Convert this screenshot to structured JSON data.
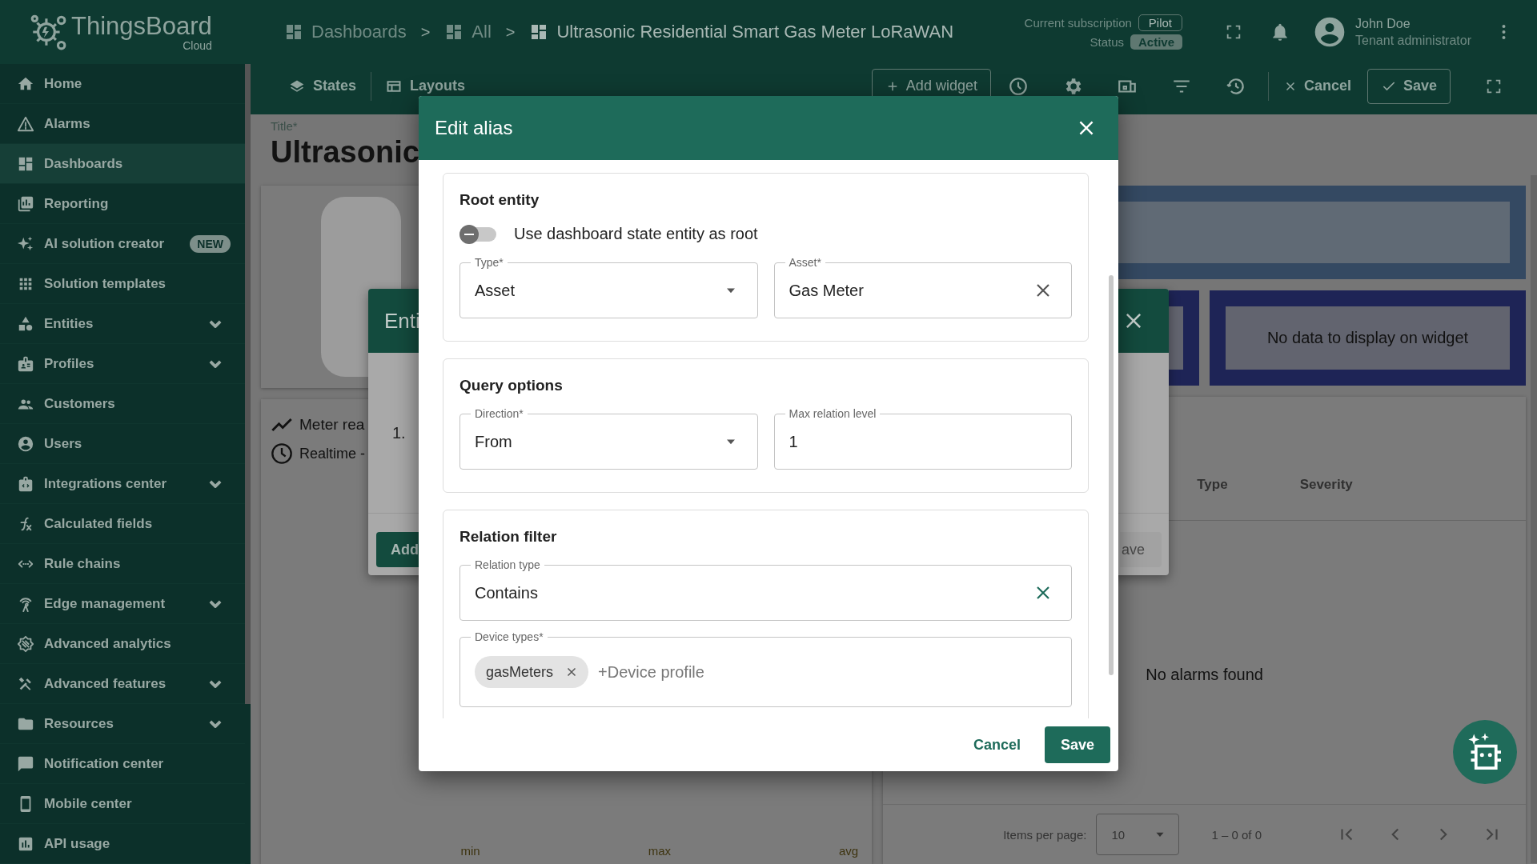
{
  "header": {
    "logo": {
      "name": "ThingsBoard",
      "sub": "Cloud"
    },
    "breadcrumbs": [
      {
        "label": "Dashboards",
        "separator": ">"
      },
      {
        "label": "All",
        "separator": ">"
      },
      {
        "label": "Ultrasonic Residential Smart Gas Meter LoRaWAN"
      }
    ],
    "subscription": {
      "label": "Current subscription",
      "value": "Pilot"
    },
    "status": {
      "label": "Status",
      "value": "Active"
    },
    "user": {
      "name": "John Doe",
      "role": "Tenant administrator"
    }
  },
  "sidebar": {
    "items": [
      {
        "label": "Home",
        "selected": false,
        "expandable": false
      },
      {
        "label": "Alarms",
        "selected": false,
        "expandable": false
      },
      {
        "label": "Dashboards",
        "selected": true,
        "expandable": false
      },
      {
        "label": "Reporting",
        "selected": false,
        "expandable": false
      },
      {
        "label": "AI solution creator",
        "selected": false,
        "expandable": false,
        "badge": "NEW"
      },
      {
        "label": "Solution templates",
        "selected": false,
        "expandable": false
      },
      {
        "label": "Entities",
        "selected": false,
        "expandable": true
      },
      {
        "label": "Profiles",
        "selected": false,
        "expandable": true
      },
      {
        "label": "Customers",
        "selected": false,
        "expandable": false
      },
      {
        "label": "Users",
        "selected": false,
        "expandable": false
      },
      {
        "label": "Integrations center",
        "selected": false,
        "expandable": true
      },
      {
        "label": "Calculated fields",
        "selected": false,
        "expandable": false
      },
      {
        "label": "Rule chains",
        "selected": false,
        "expandable": false
      },
      {
        "label": "Edge management",
        "selected": false,
        "expandable": true
      },
      {
        "label": "Advanced analytics",
        "selected": false,
        "expandable": false
      },
      {
        "label": "Advanced features",
        "selected": false,
        "expandable": true
      },
      {
        "label": "Resources",
        "selected": false,
        "expandable": true
      },
      {
        "label": "Notification center",
        "selected": false,
        "expandable": false
      },
      {
        "label": "Mobile center",
        "selected": false,
        "expandable": false
      },
      {
        "label": "API usage",
        "selected": false,
        "expandable": false
      }
    ]
  },
  "toolbar": {
    "tabs": [
      "States",
      "Layouts"
    ],
    "add_widget": "Add widget",
    "cancel": "Cancel",
    "save": "Save"
  },
  "dashboard": {
    "title_label": "Title*",
    "title": "Ultrasonic",
    "chart_widget": {
      "title": "Meter rea",
      "timewindow": "Realtime - ",
      "legend": [
        "min",
        "max",
        "avg"
      ]
    },
    "no_data": "No data to display on widget",
    "alarms": {
      "columns": [
        "Type",
        "Severity"
      ],
      "empty": "No alarms found",
      "paginator": {
        "label": "Items per page:",
        "page_size": "10",
        "range": "1 – 0 of 0"
      }
    }
  },
  "back_dialog": {
    "title": "Enti",
    "row_number": "1.",
    "add_button": "Add",
    "save_button": "ave"
  },
  "dialog": {
    "title": "Edit alias",
    "sections": [
      {
        "title": "Root entity",
        "toggle": {
          "label": "Use dashboard state entity as root",
          "on": false
        },
        "rows": [
          [
            {
              "label": "Type*",
              "value": "Asset",
              "kind": "select"
            },
            {
              "label": "Asset*",
              "value": "Gas Meter",
              "kind": "clearable",
              "clear_accent": false
            }
          ]
        ]
      },
      {
        "title": "Query options",
        "rows": [
          [
            {
              "label": "Direction*",
              "value": "From",
              "kind": "select"
            },
            {
              "label": "Max relation level",
              "value": "1",
              "kind": "text"
            }
          ]
        ]
      },
      {
        "title": "Relation filter",
        "rows": [
          [
            {
              "label": "Relation type",
              "value": "Contains",
              "kind": "clearable",
              "clear_accent": true
            }
          ],
          [
            {
              "label": "Device types*",
              "kind": "chips",
              "chips": [
                "gasMeters"
              ],
              "placeholder": "+Device profile"
            }
          ]
        ]
      }
    ],
    "cancel": "Cancel",
    "save": "Save"
  }
}
